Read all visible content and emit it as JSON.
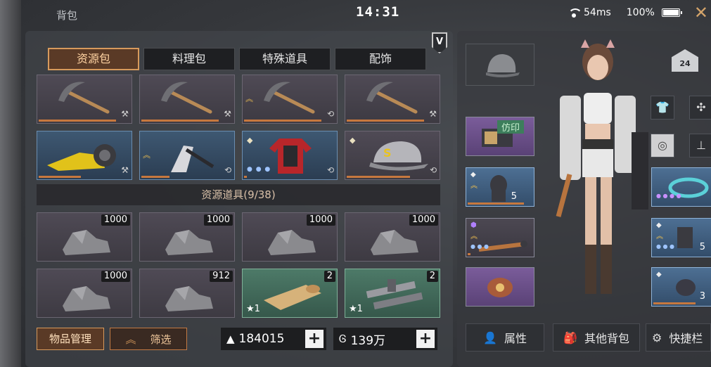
{
  "status": {
    "title": "背包",
    "time": "14:31",
    "ping": "54ms",
    "battery": "100%"
  },
  "tabs": [
    {
      "label": "资源包",
      "active": true
    },
    {
      "label": "料理包",
      "active": false
    },
    {
      "label": "特殊道具",
      "active": false
    },
    {
      "label": "配饰",
      "active": false
    }
  ],
  "section_title": "资源道具(9/38)",
  "top_items": [
    {
      "icon": "pickaxe-icon",
      "quality": "purple"
    },
    {
      "icon": "pickaxe-icon",
      "quality": "purple"
    },
    {
      "icon": "pickaxe-icon",
      "quality": "purple"
    },
    {
      "icon": "pickaxe-icon",
      "quality": "purple"
    },
    {
      "icon": "chainsaw-icon",
      "quality": "blue"
    },
    {
      "icon": "axe-icon",
      "quality": "blue"
    },
    {
      "icon": "armor-jacket-icon",
      "quality": "blue"
    },
    {
      "icon": "cap-icon",
      "quality": "purple"
    }
  ],
  "resources": [
    {
      "icon": "stone-icon",
      "count": "1000",
      "quality": "purple"
    },
    {
      "icon": "stone-icon",
      "count": "1000",
      "quality": "purple"
    },
    {
      "icon": "stone-icon",
      "count": "1000",
      "quality": "purple"
    },
    {
      "icon": "stone-icon",
      "count": "1000",
      "quality": "purple"
    },
    {
      "icon": "stone-icon",
      "count": "1000",
      "quality": "purple"
    },
    {
      "icon": "stone-icon",
      "count": "912",
      "quality": "purple"
    },
    {
      "icon": "blueprint-scroll-icon",
      "count": "2",
      "quality": "green",
      "star": "1"
    },
    {
      "icon": "metal-pipes-icon",
      "count": "2",
      "quality": "green",
      "star": "1"
    }
  ],
  "buttons": {
    "manage": "物品管理",
    "filter": "筛选"
  },
  "currency": {
    "ore": "184015",
    "gold": "139万"
  },
  "equipment": {
    "tag": "仿印",
    "level": "24",
    "counts": [
      "5",
      "5",
      "3"
    ]
  },
  "bottom_nav": {
    "attributes": "属性",
    "other_bags": "其他背包",
    "shortcut": "快捷栏"
  },
  "colors": {
    "accent": "#d79a5c",
    "purple": "#5a4276",
    "blue": "#334d6a",
    "green": "#36584b"
  }
}
